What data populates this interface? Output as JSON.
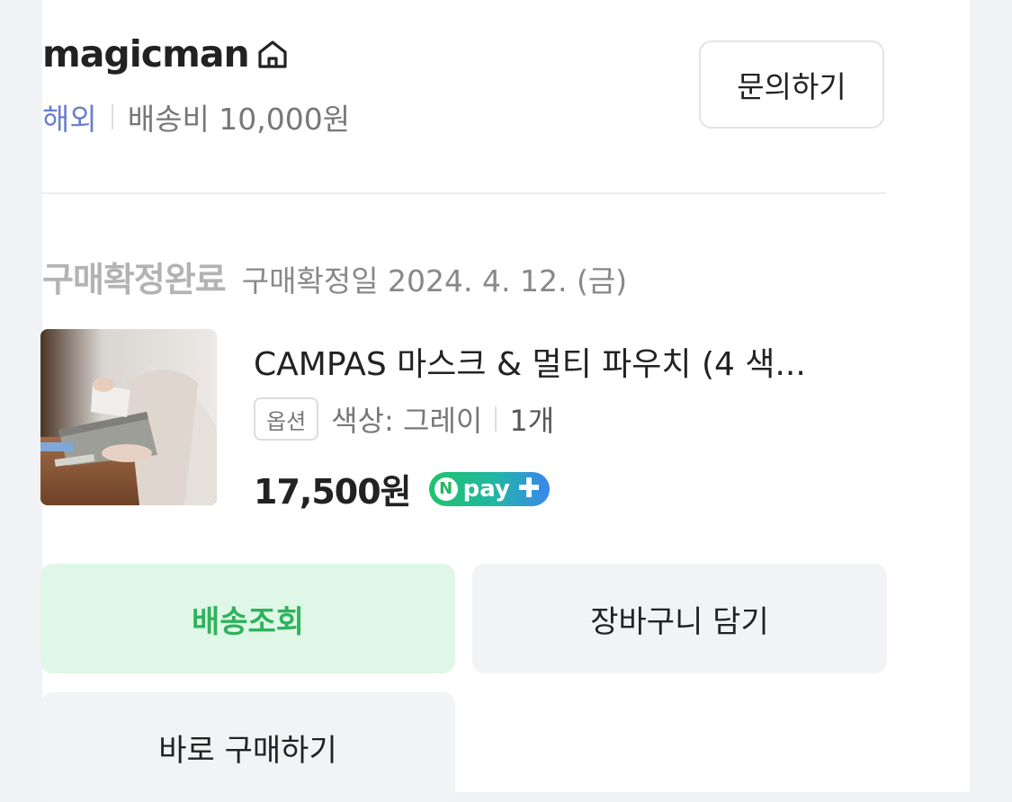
{
  "store": {
    "name": "magicman",
    "region": "해외",
    "shipping": "배송비 10,000원",
    "inquiry_label": "문의하기"
  },
  "order": {
    "status": "구매확정완료",
    "date": "구매확정일 2024. 4. 12. (금)"
  },
  "product": {
    "name": "CAMPAS 마스크 & 멀티 파우치 (4 색...",
    "option_badge": "옵션",
    "option_value": "색상: 그레이",
    "quantity": "1개",
    "price": "17,500원",
    "pay_badge": "pay"
  },
  "actions": {
    "track": "배송조회",
    "cart": "장바구니 담기",
    "buy_now": "바로 구매하기"
  },
  "colors": {
    "region_link": "#6b7fd0",
    "track_bg": "#dff7e6",
    "track_text": "#2eb35c",
    "npay_green": "#1fc46b"
  }
}
